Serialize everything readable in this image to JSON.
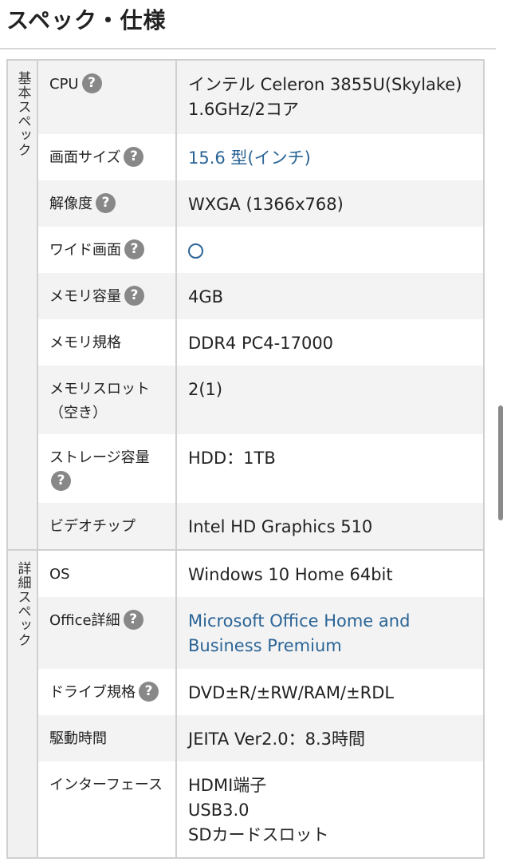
{
  "page": {
    "title": "スペック・仕様"
  },
  "sections": [
    {
      "label": "基本スペック",
      "rows": [
        {
          "label": "CPU",
          "help": true,
          "value_lines": [
            "インテル Celeron 3855U(Skylake)",
            "1.6GHz/2コア"
          ]
        },
        {
          "label": "画面サイズ",
          "help": true,
          "value_lines": [
            "15.6 型(インチ)"
          ],
          "link": true
        },
        {
          "label": "解像度",
          "help": true,
          "value_lines": [
            "WXGA (1366x768)"
          ]
        },
        {
          "label": "ワイド画面",
          "help": true,
          "value_lines": [],
          "mark": "circle"
        },
        {
          "label": "メモリ容量",
          "help": true,
          "value_lines": [
            "4GB"
          ]
        },
        {
          "label": "メモリ規格",
          "help": false,
          "value_lines": [
            "DDR4 PC4-17000"
          ]
        },
        {
          "label": "メモリスロット（空き）",
          "help": false,
          "value_lines": [
            "2(1)"
          ]
        },
        {
          "label": "ストレージ容量",
          "help": true,
          "value_lines": [
            "HDD：1TB"
          ]
        },
        {
          "label": "ビデオチップ",
          "help": false,
          "value_lines": [
            "Intel HD Graphics 510"
          ]
        }
      ]
    },
    {
      "label": "詳細スペック",
      "rows": [
        {
          "label": "OS",
          "help": false,
          "value_lines": [
            "Windows 10 Home 64bit"
          ]
        },
        {
          "label": "Office詳細",
          "help": true,
          "value_lines": [
            "Microsoft Office Home and",
            "Business Premium"
          ],
          "link": true
        },
        {
          "label": "ドライブ規格",
          "help": true,
          "value_lines": [
            "DVD±R/±RW/RAM/±RDL"
          ]
        },
        {
          "label": "駆動時間",
          "help": false,
          "value_lines": [
            "JEITA Ver2.0：8.3時間"
          ]
        },
        {
          "label": "インターフェース",
          "help": false,
          "value_lines": [
            "HDMI端子",
            "USB3.0",
            "SDカードスロット"
          ]
        }
      ]
    }
  ],
  "help_icon_glyph": "?",
  "colors": {
    "link": "#2a6496",
    "shade": "#f3f3f3",
    "help_icon": "#888888"
  }
}
